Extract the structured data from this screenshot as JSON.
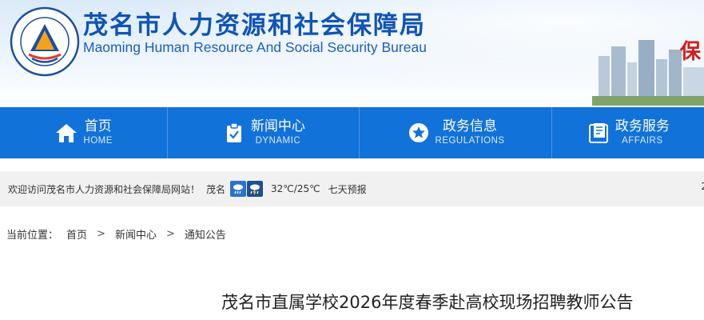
{
  "header": {
    "title": "茂名市人力资源和社会保障局",
    "subtitle": "Maoming Human Resource And Social Security Bureau",
    "emblem_text": "茂名市人力资源和社会保障局",
    "slogan_char": "保"
  },
  "nav": {
    "items": [
      {
        "label": "首页",
        "sub": "HOME",
        "icon": "home-icon"
      },
      {
        "label": "新闻中心",
        "sub": "DYNAMIC",
        "icon": "clipboard-check-icon"
      },
      {
        "label": "政务信息",
        "sub": "REGULATIONS",
        "icon": "star-icon"
      },
      {
        "label": "政务服务",
        "sub": "AFFAIRS",
        "icon": "document-icon"
      }
    ]
  },
  "welcome": {
    "text": "欢迎访问茂名市人力资源和社会保障局网站！",
    "city": "茂名",
    "weather_icons": [
      "rain-icon",
      "thunderstorm-icon"
    ],
    "temperature": "32℃/25℃",
    "forecast": "七天预报",
    "right_edge": "2"
  },
  "breadcrumb": {
    "label": "当前位置：",
    "items": [
      "首页",
      "新闻中心",
      "通知公告"
    ],
    "separator": ">"
  },
  "article": {
    "title": "茂名市直属学校2026年度春季赴高校现场招聘教师公告"
  },
  "colors": {
    "nav_bg": "#1172d9",
    "title_blue": "#0f54b5",
    "bar_bg": "#f1f1f1"
  }
}
